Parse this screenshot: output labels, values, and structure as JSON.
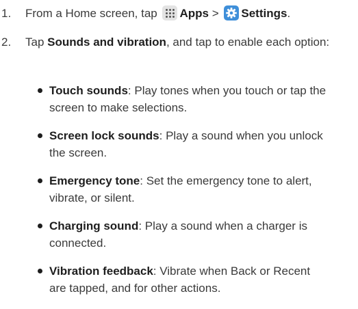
{
  "steps": [
    {
      "number": "1.",
      "intro": "From a Home screen, tap",
      "apps_label": "Apps",
      "separator": ">",
      "settings_label": "Settings",
      "end": "."
    },
    {
      "number": "2.",
      "intro": "Tap",
      "bold": "Sounds and vibration",
      "rest": ", and tap to enable each option:"
    }
  ],
  "icons": {
    "apps": "apps-grid-icon",
    "settings": "settings-gear-icon",
    "settings_color": "#3f8fd9"
  },
  "bullets": [
    {
      "term": "Touch sounds",
      "description": ": Play tones when you touch or tap the screen to make selections."
    },
    {
      "term": "Screen lock sounds",
      "description": ": Play a sound when you unlock the screen."
    },
    {
      "term": "Emergency tone",
      "description": ": Set the emergency tone to alert, vibrate, or silent."
    },
    {
      "term": "Charging sound",
      "description": ": Play a sound when a charger is connected."
    },
    {
      "term": "Vibration feedback",
      "description": ": Vibrate when Back or Recent are tapped, and for other actions."
    }
  ]
}
